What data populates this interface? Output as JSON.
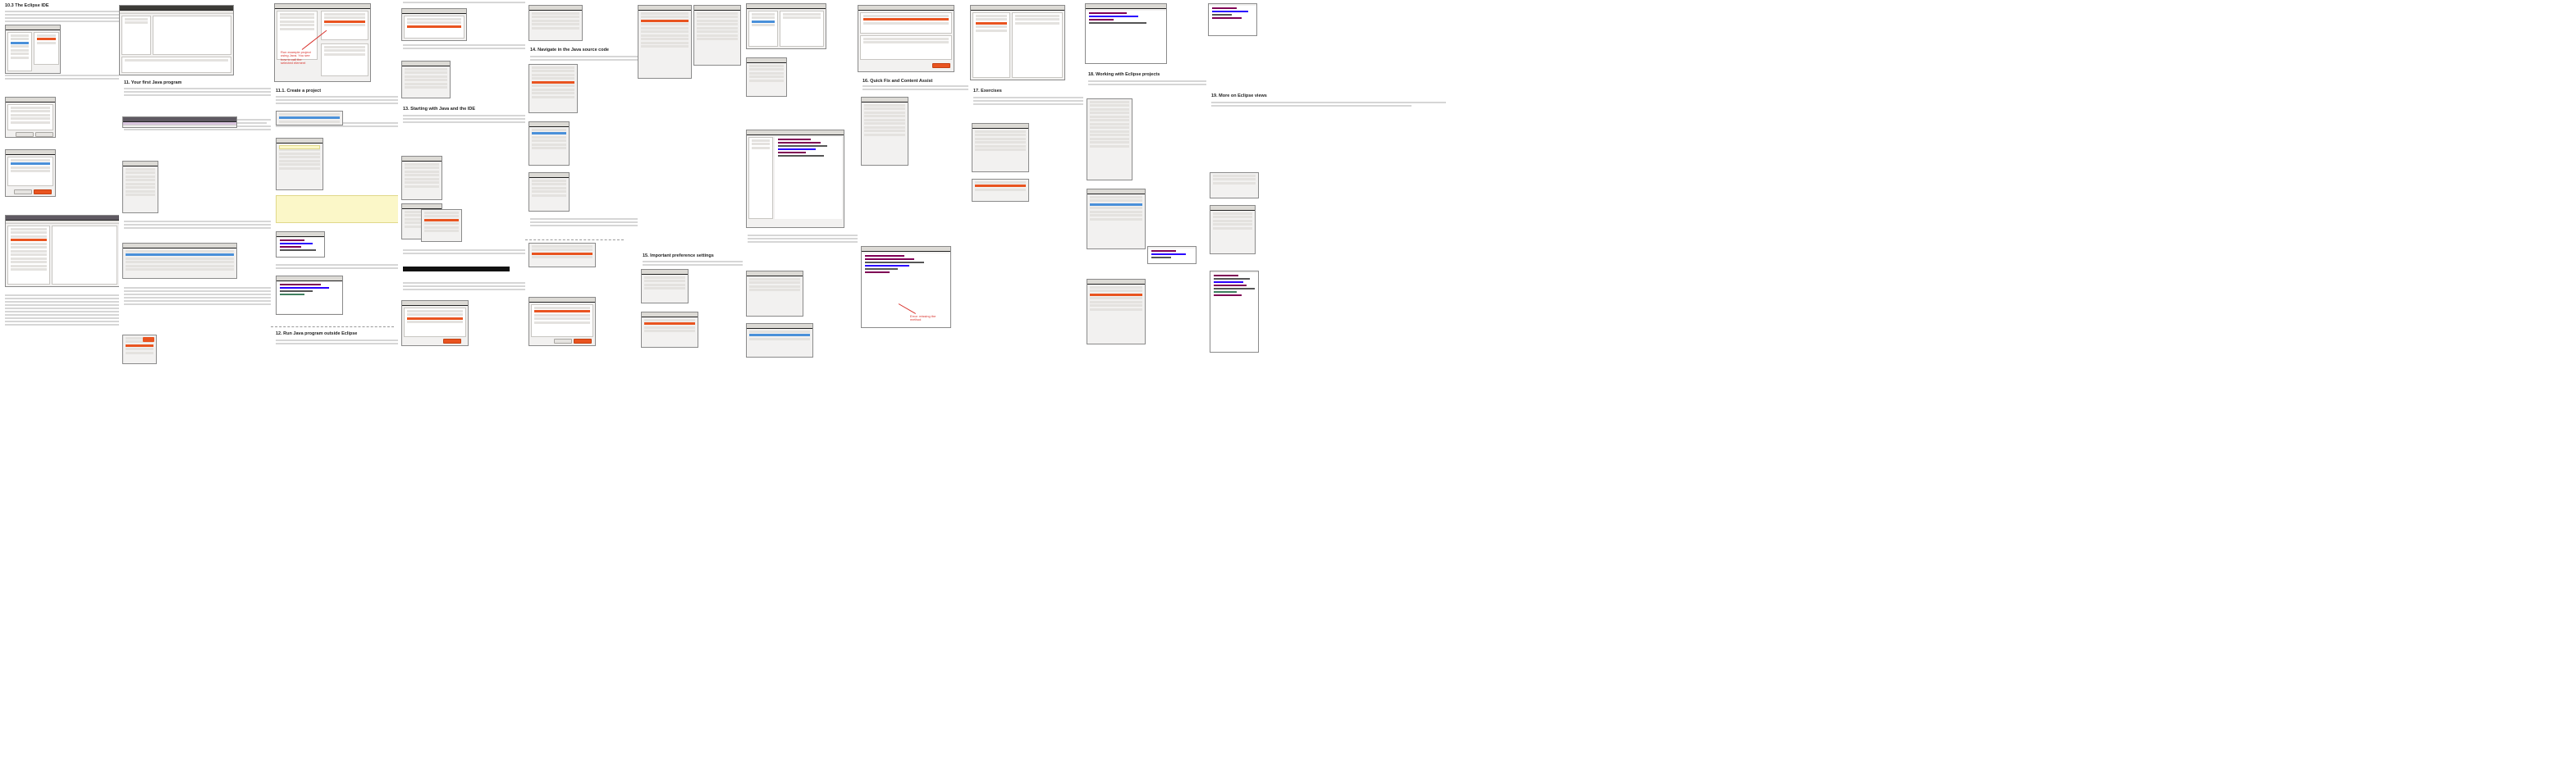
{
  "document": {
    "columns": [
      {
        "id": "c1",
        "heading": "10.3 The Eclipse IDE"
      },
      {
        "id": "c2",
        "heading": "11. Your first Java program"
      },
      {
        "id": "c3",
        "heading": "11.1. Create a project"
      },
      {
        "id": "c4",
        "heading": "12. Run Java program outside Eclipse"
      },
      {
        "id": "c5",
        "heading": "13. Starting with Java and the IDE"
      },
      {
        "id": "c6",
        "heading": "14. Navigate in the Java source code"
      },
      {
        "id": "c7",
        "heading": "15. Important preference settings"
      },
      {
        "id": "c8",
        "heading": "16. Quick Fix and Content Assist"
      },
      {
        "id": "c9",
        "heading": "17. Exercises"
      },
      {
        "id": "c10",
        "heading": "18. Working with Eclipse projects"
      },
      {
        "id": "c11",
        "heading": "19. More on Eclipse views"
      }
    ],
    "annotations": {
      "c3_callout": "Run example project using Java. You see how to call the selected element",
      "c6_callout": "Error: missing the method"
    }
  },
  "colors": {
    "accent": "#e95420",
    "titlebar": "#3c3b37",
    "keyword": "#7f0055",
    "string": "#2a00ff",
    "callout": "#d8312b"
  }
}
